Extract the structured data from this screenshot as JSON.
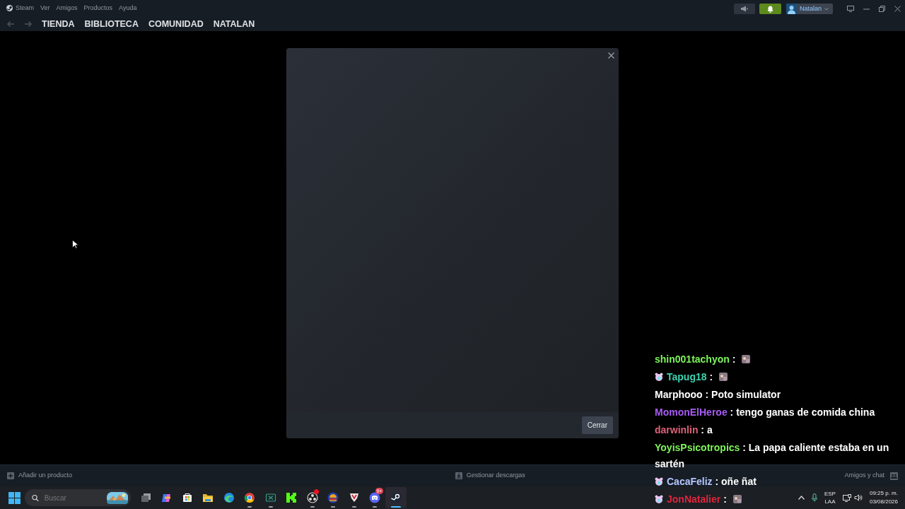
{
  "menu": [
    "Steam",
    "Ver",
    "Amigos",
    "Productos",
    "Ayuda"
  ],
  "nav_tabs": [
    "TIENDA",
    "BIBLIOTECA",
    "COMUNIDAD",
    "NATALAN"
  ],
  "account": {
    "name": "Natalan",
    "notifications_on": true
  },
  "dialog": {
    "button": "Cerrar"
  },
  "bottom_bar": {
    "add_product": "Añadir un producto",
    "downloads": "Gestionar descargas",
    "friends": "Amigos y chat"
  },
  "taskbar": {
    "search_placeholder": "Buscar",
    "apps": [
      {
        "kind": "taskview",
        "running": false,
        "selected": false
      },
      {
        "kind": "assistant",
        "running": false,
        "selected": false
      },
      {
        "kind": "store",
        "running": false,
        "selected": false
      },
      {
        "kind": "folder",
        "running": false,
        "selected": false
      },
      {
        "kind": "browser-wave",
        "running": false,
        "selected": false
      },
      {
        "kind": "browser-ring",
        "running": true,
        "selected": false
      },
      {
        "kind": "crossbox",
        "running": true,
        "selected": false
      },
      {
        "kind": "letter-k",
        "running": false,
        "selected": false
      },
      {
        "kind": "recorder",
        "running": true,
        "selected": false,
        "alert": true
      },
      {
        "kind": "burger",
        "running": true,
        "selected": false
      },
      {
        "kind": "mug",
        "running": true,
        "selected": false
      },
      {
        "kind": "gamepad",
        "running": true,
        "selected": false,
        "badge": "9+"
      },
      {
        "kind": "steam",
        "running": true,
        "selected": true
      }
    ],
    "tray": {
      "language": "ESP",
      "layout": "LAA",
      "time": "09:25 p. m.",
      "date": "03/08/2026"
    }
  },
  "chat": [
    {
      "user": "shin001tachyon",
      "color": "#7ef35b",
      "badge": false,
      "separator": ":",
      "emote": true
    },
    {
      "user": "Tapug18",
      "color": "#3fd1b0",
      "badge": true,
      "separator": ":",
      "emote": true
    },
    {
      "user": "Marphooo",
      "color": "#ffffff",
      "badge": false,
      "separator": ":",
      "emote": false,
      "text": "Poto simulator"
    },
    {
      "user": "MomonElHeroe",
      "color": "#a65cf0",
      "badge": false,
      "separator": ":",
      "emote": false,
      "text": "tengo ganas de comida china"
    },
    {
      "user": "darwinlin",
      "color": "#dd6078",
      "badge": false,
      "separator": ":",
      "emote": false,
      "text": "a"
    },
    {
      "user": "YoyisPsicotropics",
      "color": "#7ef35b",
      "badge": false,
      "separator": ":",
      "emote": false,
      "text": "La papa caliente estaba en un sartén"
    },
    {
      "user": "CacaFeliz",
      "color": "#b4c6ff",
      "badge": true,
      "separator": ":",
      "emote": false,
      "text": "oñe ñat"
    },
    {
      "user": "JonNatalier",
      "color": "#e0243c",
      "badge": true,
      "separator": ":",
      "emote": true
    }
  ]
}
